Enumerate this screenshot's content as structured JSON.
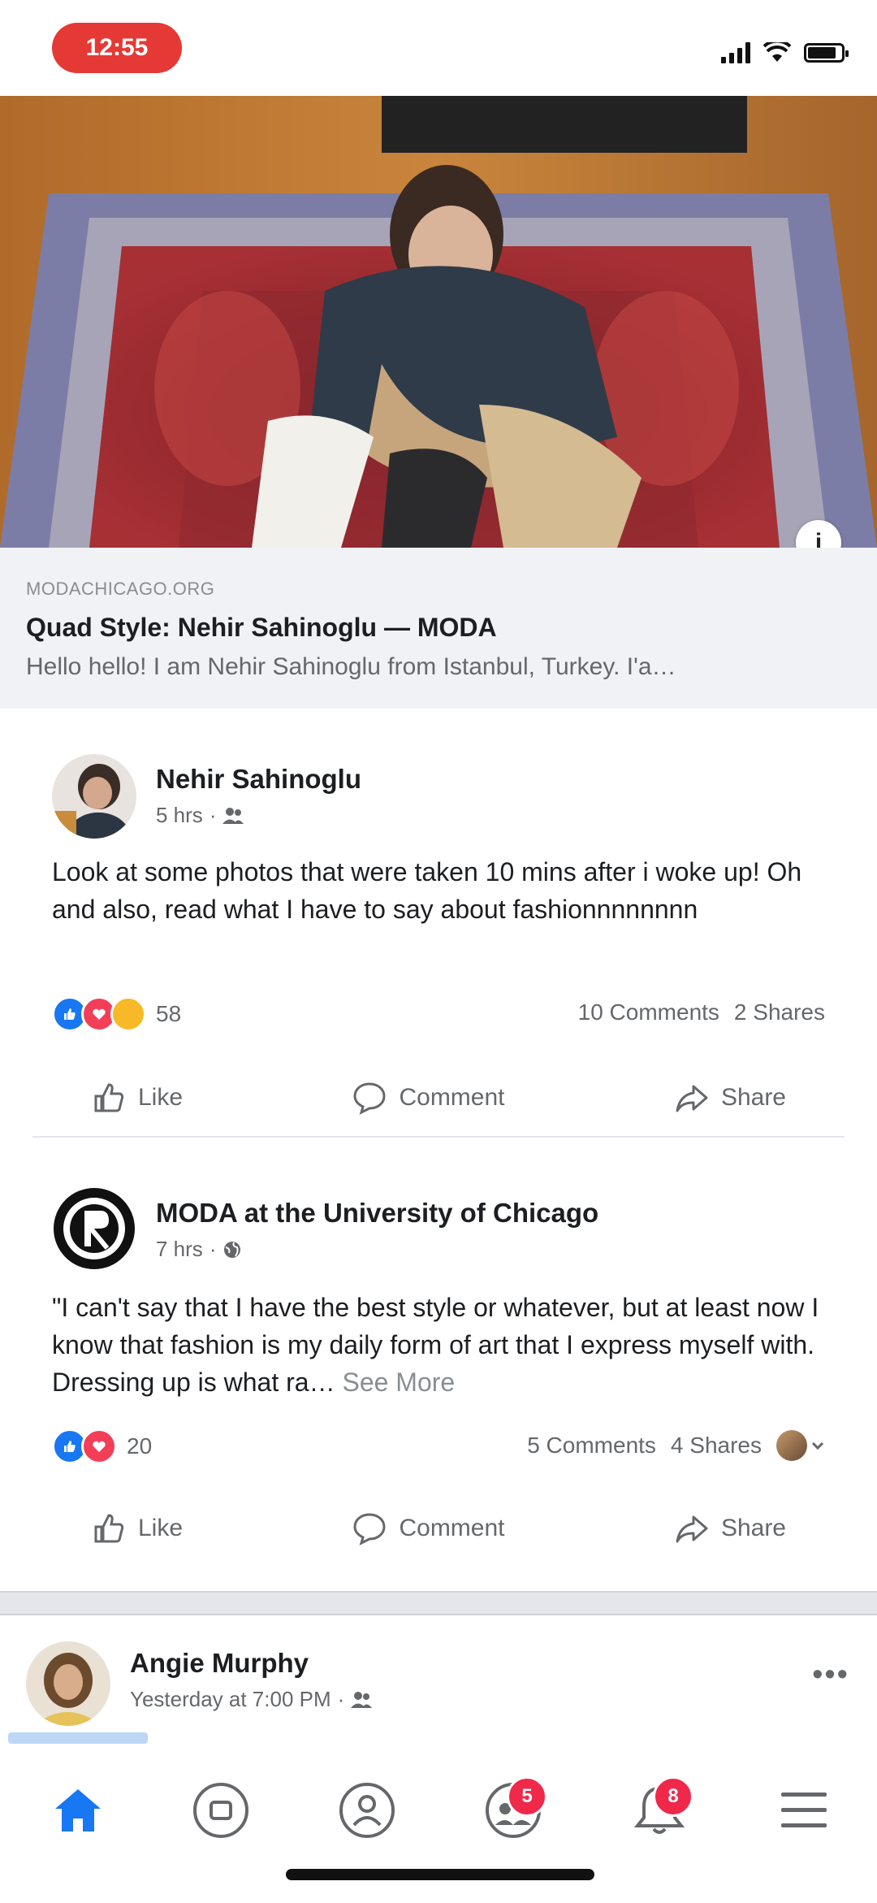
{
  "status_bar": {
    "time": "12:55"
  },
  "link_preview": {
    "domain": "MODACHICAGO.ORG",
    "title": "Quad Style: Nehir Sahinoglu — MODA",
    "description": "Hello hello! I am Nehir Sahinoglu from Istanbul, Turkey. I'a…"
  },
  "posts": [
    {
      "author": "Nehir Sahinoglu",
      "time": "5 hrs",
      "text": "Look at some photos that were taken 10 mins after i woke up! Oh and also, read what I have to say about fashionnnnnnnn",
      "reactions_count": "58",
      "comments": "10 Comments",
      "shares": "2 Shares",
      "like_label": "Like",
      "comment_label": "Comment",
      "share_label": "Share"
    },
    {
      "author": "MODA at the University of Chicago",
      "time": "7 hrs",
      "text": "\"I can't say that I have the best style or whatever, but at least now I know that fashion is my daily form of art that I express myself with. Dressing up is what ra…",
      "see_more": "See More",
      "reactions_count": "20",
      "comments": "5 Comments",
      "shares": "4 Shares",
      "like_label": "Like",
      "comment_label": "Comment",
      "share_label": "Share"
    },
    {
      "author": "Angie Murphy",
      "time": "Yesterday at 7:00 PM"
    }
  ],
  "bottom_nav": {
    "groups_badge": "5",
    "notifications_badge": "8"
  },
  "colors": {
    "accent": "#1877f2",
    "badge": "#f02849"
  }
}
